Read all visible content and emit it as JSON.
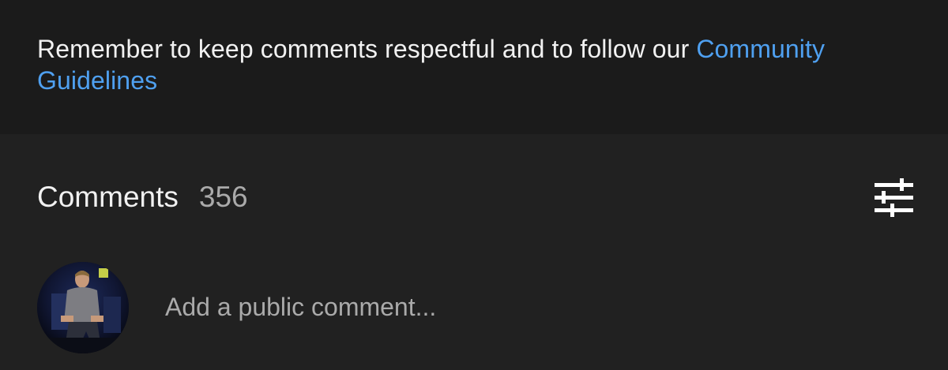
{
  "notice": {
    "text": "Remember to keep comments respectful and to follow our ",
    "link_text": "Community Guidelines"
  },
  "comments": {
    "title": "Comments",
    "count": "356",
    "sort_icon": "sort-sliders-icon",
    "input_placeholder": "Add a public comment..."
  },
  "colors": {
    "notice_background": "#1b1b1b",
    "background": "#212121",
    "link": "#4fa0f0",
    "primary_text": "#f1f1f1",
    "secondary_text": "#aaaaaa"
  }
}
